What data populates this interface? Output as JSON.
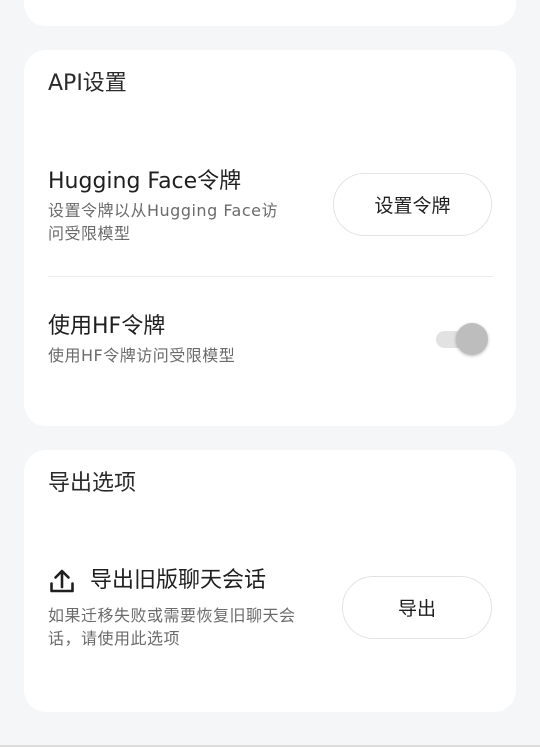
{
  "api_section": {
    "title": "API设置",
    "hf_token": {
      "title": "Hugging Face令牌",
      "description_line1": "设置令牌以从Hugging Face访",
      "description_line2": "问受限模型",
      "button_label": "设置令牌"
    },
    "use_hf_token": {
      "title": "使用HF令牌",
      "description": "使用HF令牌访问受限模型",
      "enabled": true
    }
  },
  "export_section": {
    "title": "导出选项",
    "legacy_export": {
      "icon": "upload-icon",
      "title": "导出旧版聊天会话",
      "description_line1": "如果迁移失败或需要恢复旧聊天会",
      "description_line2": "话，请使用此选项",
      "button_label": "导出"
    }
  }
}
